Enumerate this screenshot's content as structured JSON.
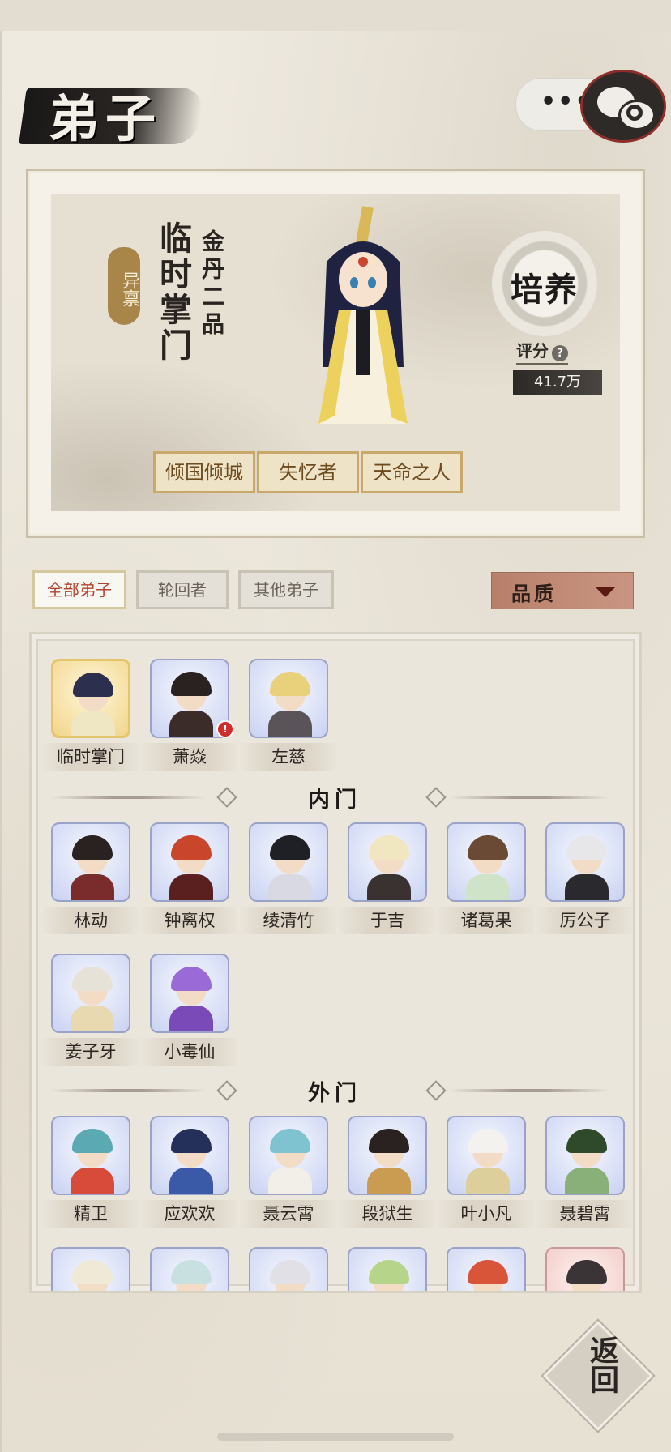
{
  "header": {
    "title": "弟子",
    "capsule_dots": "•••"
  },
  "hero": {
    "rank_badge": "异禀",
    "name": "临时掌门",
    "realm": "金丹二品",
    "cultivate_label": "培养",
    "score_label": "评分",
    "score_help": "?",
    "score_value": "41.7万",
    "traits": [
      "倾国倾城",
      "失忆者",
      "天命之人"
    ]
  },
  "tabs": [
    "全部弟子",
    "轮回者",
    "其他弟子"
  ],
  "sort": {
    "label": "品质"
  },
  "groups": {
    "core": [
      {
        "name": "临时掌门",
        "theme": "gold",
        "hair": "#2c2f4d",
        "robe": "#efe6c3"
      },
      {
        "name": "萧焱",
        "theme": "blue",
        "hair": "#2a2220",
        "robe": "#3b2c2a",
        "alert": "!"
      },
      {
        "name": "左慈",
        "theme": "blue",
        "hair": "#e9d07a",
        "robe": "#5a5358"
      }
    ],
    "inner_label": "内门",
    "inner": [
      {
        "name": "林动",
        "theme": "blue",
        "hair": "#2a2220",
        "robe": "#7a2b2b"
      },
      {
        "name": "钟离权",
        "theme": "blue",
        "hair": "#c9452c",
        "robe": "#5a2020"
      },
      {
        "name": "绫清竹",
        "theme": "blue",
        "hair": "#1f1f26",
        "robe": "#d9d9e3"
      },
      {
        "name": "于吉",
        "theme": "blue",
        "hair": "#f0e6c0",
        "robe": "#3a3230"
      },
      {
        "name": "诸葛果",
        "theme": "blue",
        "hair": "#6a4a34",
        "robe": "#cfe3c8"
      },
      {
        "name": "厉公子",
        "theme": "blue",
        "hair": "#e7e7ea",
        "robe": "#2a2a2e"
      },
      {
        "name": "姜子牙",
        "theme": "blue",
        "hair": "#e6e2d8",
        "robe": "#e9d9b0"
      },
      {
        "name": "小毒仙",
        "theme": "blue",
        "hair": "#9a6bd6",
        "robe": "#7a4ab8"
      }
    ],
    "outer_label": "外门",
    "outer": [
      {
        "name": "精卫",
        "theme": "blue",
        "hair": "#5ba9b2",
        "robe": "#d84b3a"
      },
      {
        "name": "应欢欢",
        "theme": "blue",
        "hair": "#25305a",
        "robe": "#3a5aa8"
      },
      {
        "name": "聂云霄",
        "theme": "blue",
        "hair": "#7fc3d0",
        "robe": "#f2eee8"
      },
      {
        "name": "段狱生",
        "theme": "blue",
        "hair": "#2a2220",
        "robe": "#c99c52"
      },
      {
        "name": "叶小凡",
        "theme": "blue",
        "hair": "#f4f2ee",
        "robe": "#dccf9c"
      },
      {
        "name": "聂碧霄",
        "theme": "blue",
        "hair": "#2e4a2a",
        "robe": "#8ab07a"
      }
    ],
    "partial_row": [
      {
        "theme": "blue",
        "hair": "#efe9d6",
        "robe": "#cfd6ee"
      },
      {
        "theme": "blue",
        "hair": "#c9e0e0",
        "robe": "#cfd6ee"
      },
      {
        "theme": "blue",
        "hair": "#e0e0e6",
        "robe": "#cfd6ee"
      },
      {
        "theme": "blue",
        "hair": "#b6d48a",
        "robe": "#cfd6ee"
      },
      {
        "theme": "blue",
        "hair": "#d9553a",
        "robe": "#cfd6ee"
      },
      {
        "theme": "red",
        "hair": "#3a3436",
        "robe": "#e8c7c1"
      }
    ]
  },
  "back_label": "返回"
}
